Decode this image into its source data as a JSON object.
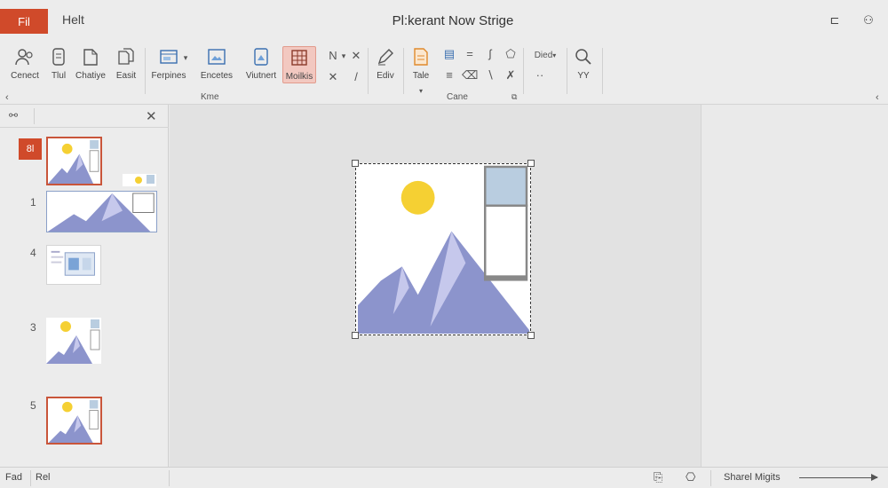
{
  "titlebar": {
    "file_tab": "Fil",
    "help_tab": "Helt",
    "document_title": "Pl:kerant Now Strige",
    "minimize_glyph": "⊏",
    "tell_me_glyph": "⚇"
  },
  "ribbon": {
    "buttons": [
      {
        "label": "Cenect",
        "icon": "people-icon"
      },
      {
        "label": "Tlul",
        "icon": "document-icon"
      },
      {
        "label": "Chatiye",
        "icon": "page-icon"
      },
      {
        "label": "Easit",
        "icon": "pages-icon"
      },
      {
        "label": "Ferpines",
        "icon": "layout-icon"
      },
      {
        "label": "Encetes",
        "icon": "picture-icon"
      },
      {
        "label": "Viutnert",
        "icon": "shape-icon"
      },
      {
        "label": "Moilkis",
        "icon": "table-icon"
      },
      {
        "label": "Ediv",
        "icon": "pencil-icon"
      },
      {
        "label": "Tale",
        "icon": "note-icon"
      }
    ],
    "small_tools": [
      "N",
      "✕",
      "✕",
      "/",
      "≡",
      "⌫",
      "∖",
      "⊞",
      "✗"
    ],
    "dropdown_label": "Died",
    "dots_label": "··",
    "search_label": "YY",
    "group_labels": {
      "image": "Kme",
      "cane": "Cane"
    },
    "collapse_glyph": "‹",
    "expand_glyph": "‹",
    "active_color": "#f2c8c0"
  },
  "thumbnails": {
    "pane_icon": "⚯",
    "close_glyph": "✕",
    "badge": "8l",
    "slide_numbers": [
      "1",
      "4",
      "3",
      "5"
    ]
  },
  "canvas": {
    "sun_color": "#f5d033",
    "mountain_color": "#8c94cc",
    "peak_color": "#c6c8ec",
    "box_color": "#b9cde0"
  },
  "statusbar": {
    "left_label": "Fad",
    "second_label": "Rel",
    "zoom_label": "Sharel Migits",
    "comment_glyph": "⎘",
    "lock_glyph": "⎔"
  }
}
